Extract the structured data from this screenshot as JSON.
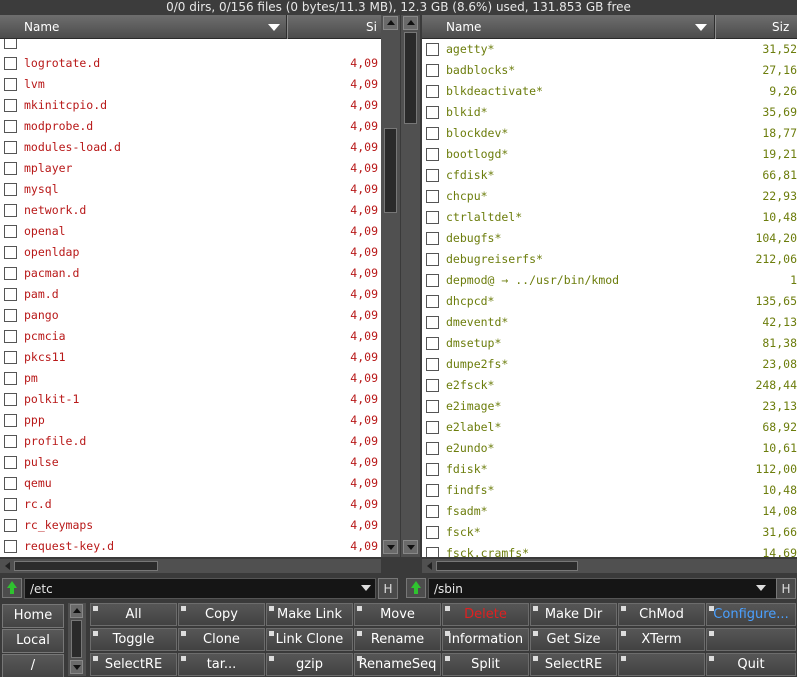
{
  "status": "0/0 dirs, 0/156 files (0 bytes/11.3 MB), 12.3 GB (8.6%) used, 131.853 GB free",
  "left": {
    "col_name": "Name",
    "col_size": "Si",
    "path": "/etc",
    "rows": [
      {
        "name": "",
        "size": ""
      },
      {
        "name": "logrotate.d",
        "size": "4,09"
      },
      {
        "name": "lvm",
        "size": "4,09"
      },
      {
        "name": "mkinitcpio.d",
        "size": "4,09"
      },
      {
        "name": "modprobe.d",
        "size": "4,09"
      },
      {
        "name": "modules-load.d",
        "size": "4,09"
      },
      {
        "name": "mplayer",
        "size": "4,09"
      },
      {
        "name": "mysql",
        "size": "4,09"
      },
      {
        "name": "network.d",
        "size": "4,09"
      },
      {
        "name": "openal",
        "size": "4,09"
      },
      {
        "name": "openldap",
        "size": "4,09"
      },
      {
        "name": "pacman.d",
        "size": "4,09"
      },
      {
        "name": "pam.d",
        "size": "4,09"
      },
      {
        "name": "pango",
        "size": "4,09"
      },
      {
        "name": "pcmcia",
        "size": "4,09"
      },
      {
        "name": "pkcs11",
        "size": "4,09"
      },
      {
        "name": "pm",
        "size": "4,09"
      },
      {
        "name": "polkit-1",
        "size": "4,09"
      },
      {
        "name": "ppp",
        "size": "4,09"
      },
      {
        "name": "profile.d",
        "size": "4,09"
      },
      {
        "name": "pulse",
        "size": "4,09"
      },
      {
        "name": "qemu",
        "size": "4,09"
      },
      {
        "name": "rc.d",
        "size": "4,09"
      },
      {
        "name": "rc_keymaps",
        "size": "4,09"
      },
      {
        "name": "request-key.d",
        "size": "4,09"
      },
      {
        "name": "",
        "size": ""
      }
    ]
  },
  "right": {
    "col_name": "Name",
    "col_size": "Siz",
    "path": "/sbin",
    "rows": [
      {
        "name": "agetty*",
        "size": "31,52"
      },
      {
        "name": "badblocks*",
        "size": "27,16"
      },
      {
        "name": "blkdeactivate*",
        "size": "9,26"
      },
      {
        "name": "blkid*",
        "size": "35,69"
      },
      {
        "name": "blockdev*",
        "size": "18,77"
      },
      {
        "name": "bootlogd*",
        "size": "19,21"
      },
      {
        "name": "cfdisk*",
        "size": "66,81"
      },
      {
        "name": "chcpu*",
        "size": "22,93"
      },
      {
        "name": "ctrlaltdel*",
        "size": "10,48"
      },
      {
        "name": "debugfs*",
        "size": "104,20"
      },
      {
        "name": "debugreiserfs*",
        "size": "212,06"
      },
      {
        "name": "depmod@ → ../usr/bin/kmod",
        "size": "1"
      },
      {
        "name": "dhcpcd*",
        "size": "135,65"
      },
      {
        "name": "dmeventd*",
        "size": "42,13"
      },
      {
        "name": "dmsetup*",
        "size": "81,38"
      },
      {
        "name": "dumpe2fs*",
        "size": "23,08"
      },
      {
        "name": "e2fsck*",
        "size": "248,44"
      },
      {
        "name": "e2image*",
        "size": "23,13"
      },
      {
        "name": "e2label*",
        "size": "68,92"
      },
      {
        "name": "e2undo*",
        "size": "10,61"
      },
      {
        "name": "fdisk*",
        "size": "112,00"
      },
      {
        "name": "findfs*",
        "size": "10,48"
      },
      {
        "name": "fsadm*",
        "size": "14,08"
      },
      {
        "name": "fsck*",
        "size": "31,66"
      },
      {
        "name": "fsck.cramfs*",
        "size": "14,69"
      }
    ]
  },
  "hbtn_label": "H",
  "nav": [
    "Home",
    "Local",
    "/"
  ],
  "buttons": [
    [
      {
        "label": "All"
      },
      {
        "label": "Copy"
      },
      {
        "label": "Make Link"
      },
      {
        "label": "Move"
      },
      {
        "label": "Delete",
        "color": "#e02020"
      },
      {
        "label": "Make Dir"
      },
      {
        "label": "ChMod"
      },
      {
        "label": "Configure...",
        "color": "#4aa0ff"
      }
    ],
    [
      {
        "label": "Toggle"
      },
      {
        "label": "Clone"
      },
      {
        "label": "Link Clone"
      },
      {
        "label": "Rename"
      },
      {
        "label": "Information"
      },
      {
        "label": "Get Size"
      },
      {
        "label": "XTerm"
      },
      {
        "label": ""
      }
    ],
    [
      {
        "label": "SelectRE"
      },
      {
        "label": "tar..."
      },
      {
        "label": "gzip"
      },
      {
        "label": "RenameSeq"
      },
      {
        "label": "Split"
      },
      {
        "label": "SelectRE"
      },
      {
        "label": ""
      },
      {
        "label": "Quit"
      }
    ]
  ]
}
